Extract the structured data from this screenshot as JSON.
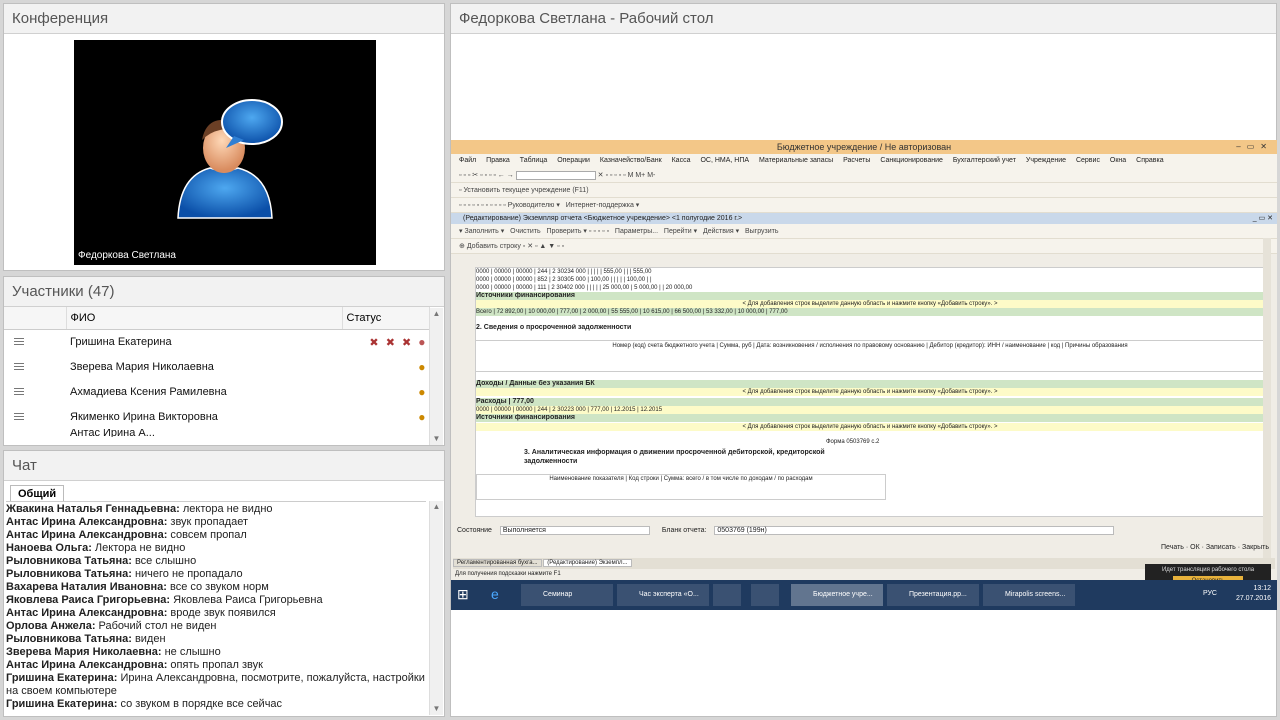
{
  "conference": {
    "title": "Конференция",
    "video_name": "Федоркова Светлана"
  },
  "participants": {
    "title": "Участники (47)",
    "col_name": "ФИО",
    "col_status": "Статус",
    "rows": [
      {
        "name": "Гришина Екатерина"
      },
      {
        "name": "Зверева Мария  Николаевна"
      },
      {
        "name": "Ахмадиева Ксения  Рамилевна"
      },
      {
        "name": "Якименко Ирина  Викторовна"
      },
      {
        "name": "Антас Ирина  А..."
      }
    ]
  },
  "chat": {
    "title": "Чат",
    "tab": "Общий",
    "messages": [
      {
        "who": "Жвакина Наталья Геннадьевна:",
        "text": " лектора не видно"
      },
      {
        "who": "Антас Ирина  Александровна:",
        "text": " звук пропадает"
      },
      {
        "who": "Антас Ирина  Александровна:",
        "text": " совсем пропал"
      },
      {
        "who": "Наноева Ольга:",
        "text": " Лектора не видно"
      },
      {
        "who": "Рыловникова  Татьяна:",
        "text": " все слышно"
      },
      {
        "who": "Рыловникова  Татьяна:",
        "text": " ничего не пропадало"
      },
      {
        "who": "Вахарева Наталия  Ивановна:",
        "text": " все со звуком норм"
      },
      {
        "who": "Яковлева Раиса Григорьевна:",
        "text": " Яковлева Раиса Григорьевна"
      },
      {
        "who": "Антас Ирина  Александровна:",
        "text": " вроде звук появился"
      },
      {
        "who": "Орлова  Анжела:",
        "text": " Рабочий стол не виден"
      },
      {
        "who": "Рыловникова  Татьяна:",
        "text": " виден"
      },
      {
        "who": "Зверева Мария  Николаевна:",
        "text": " не слышно"
      },
      {
        "who": "Антас Ирина  Александровна:",
        "text": " опять пропал звук"
      },
      {
        "who": "Гришина Екатерина:",
        "text": " Ирина Александровна, посмотрите, пожалуйста, настройки на своем компьютере"
      },
      {
        "who": "Гришина Екатерина:",
        "text": " со звуком в порядке все сейчас"
      }
    ]
  },
  "desktop": {
    "title": "Федоркова Светлана - Рабочий стол",
    "app_title": "Бюджетное учреждение / Не авторизован",
    "menu": [
      "Файл",
      "Правка",
      "Таблица",
      "Операции",
      "Казначейство/Банк",
      "Касса",
      "ОС, НМА, НПА",
      "Материальные запасы",
      "Расчеты",
      "Санкционирование",
      "Бухгалтерский учет",
      "Учреждение",
      "Сервис",
      "Окна",
      "Справка"
    ],
    "toolbar_text": "Установить текущее учреждение (F11)",
    "toolbar2": [
      "Руководителю",
      "Интернет-поддержка"
    ],
    "doc_title": "(Редактирование) Экземпляр отчета <Бюджетное учреждение> <1 полугодие 2016 г.>",
    "doc_toolbar": [
      "Заполнить",
      "Очистить",
      "Проверить",
      "Параметры...",
      "Перейти",
      "Действия",
      "Выгрузить"
    ],
    "add_row": "Добавить строку",
    "rows": [
      "0000 | 00000 | 00000 | 244 | 2 30234 000 |  |  |  |  | 555,00 |  |  | 555,00",
      "0000 | 00000 | 00000 | 852 | 2 30305 000 | 100,00 |  |  |  |  | 100,00 |  |",
      "0000 | 00000 | 00000 | 111 | 2 30402 000 |  |  |  |  | 25 000,00 | 5 000,00 |  | 20 000,00",
      "Источники финансирования",
      "< Для добавления строк выделите данную область и нажмите кнопку «Добавить строку». >",
      "Всего | 72 892,00 | 10 000,00 | 777,00 | 2 000,00 | 55 555,00 | 10 615,00 | 66 500,00 | 53 332,00 | 10 000,00 | 777,00"
    ],
    "section2": "2. Сведения о просроченной задолженности",
    "section2_head": "Номер (код) счета бюджетного учета | Сумма, руб | Дата: возникновения / исполнения по правовому основанию | Дебитор (кредитор): ИНН / наименование | код | Причины образования",
    "section2_rows": [
      "Доходы / Данные без указания БК",
      "< Для добавления строк выделите данную область и нажмите кнопку «Добавить строку». >",
      "Расходы | 777,00",
      "0000 | 00000 | 00000 | 244 | 2 30223 000 | 777,00 | 12.2015 | 12.2015",
      "Источники финансирования",
      "< Для добавления строк выделите данную область и нажмите кнопку «Добавить строку». >"
    ],
    "form_label": "Форма 0503769 с.2",
    "section3": "3. Аналитическая информация о движении просроченной дебиторской, кредиторской задолженности",
    "section3_head": "Наименование показателя | Код строки | Сумма: всего / в том числе по доходам / по расходам",
    "status_label": "Состояние",
    "status_value": "Выполняется",
    "blank_label": "Бланк отчета:",
    "blank_value": "0503769 (199н)",
    "bottom_buttons": "Печать · ОК · Записать · Закрыть",
    "tabs": [
      "Регламентированная бухга...",
      "(Редактирование) Экземпл..."
    ],
    "hint": "Для получения подсказки нажмите F1",
    "taskbar": [
      "Семинар",
      "Час эксперта «О...",
      "",
      "",
      "Бюджетное учре...",
      "Презентация.pp...",
      "Mirapolis screens..."
    ],
    "notification": "Идет трансляция рабочего стола",
    "stop": "Остановить",
    "tray": "РУС",
    "time": "13:12",
    "date": "27.07.2016"
  }
}
